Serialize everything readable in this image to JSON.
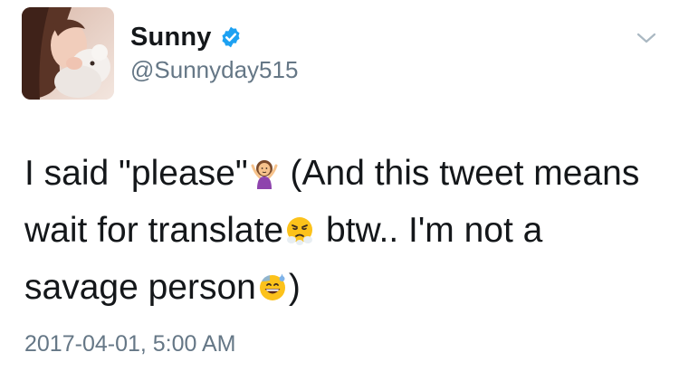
{
  "user": {
    "display_name": "Sunny",
    "handle": "@Sunnyday515",
    "verified": true
  },
  "icons": {
    "avatar": "profile-photo",
    "verified": "verified-badge-icon",
    "menu": "chevron-down-icon"
  },
  "tweet": {
    "lines": [
      [
        "I said \"please\"",
        " (And this tweet means"
      ],
      [
        "wait for translate",
        " btw.. I'm not a"
      ],
      [
        "savage person",
        ")"
      ]
    ],
    "emojis": [
      "person-gesturing-shrug-emoji",
      "steam-from-nose-face-emoji",
      "grinning-face-with-sweat-emoji"
    ]
  },
  "timestamp": "2017-04-01, 5:00 AM",
  "colors": {
    "text_primary": "#14171a",
    "text_secondary": "#657786",
    "verified_blue": "#1da1f2"
  }
}
